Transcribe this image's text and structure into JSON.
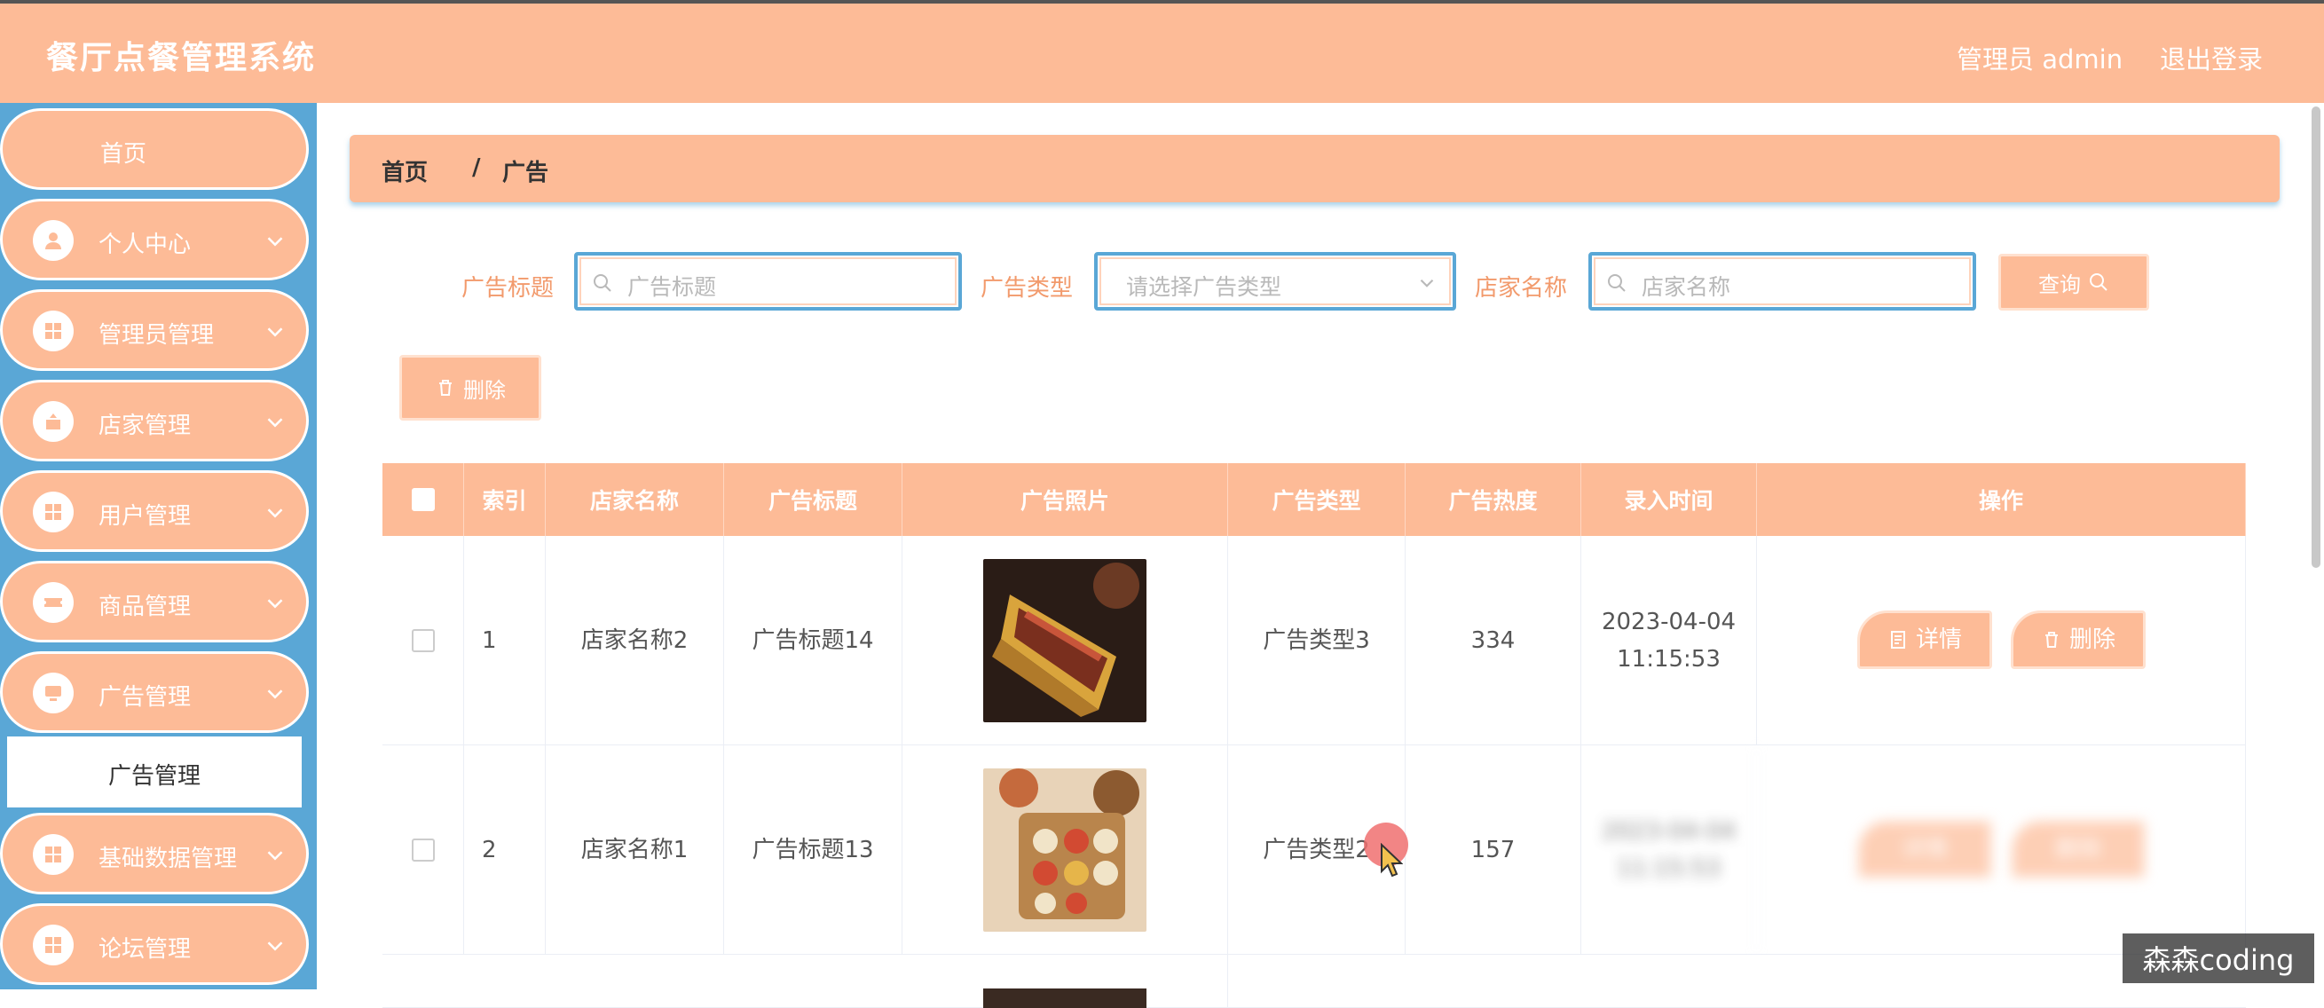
{
  "header": {
    "app_title": "餐厅点餐管理系统",
    "admin_info": "管理员 admin",
    "logout": "退出登录"
  },
  "sidebar": {
    "items": [
      {
        "label": "首页",
        "icon": "none"
      },
      {
        "label": "个人中心",
        "icon": "user-icon"
      },
      {
        "label": "管理员管理",
        "icon": "grid-icon"
      },
      {
        "label": "店家管理",
        "icon": "shop-icon"
      },
      {
        "label": "用户管理",
        "icon": "grid-icon"
      },
      {
        "label": "商品管理",
        "icon": "ticket-icon"
      },
      {
        "label": "广告管理",
        "icon": "monitor-icon"
      },
      {
        "label": "基础数据管理",
        "icon": "grid-icon"
      },
      {
        "label": "论坛管理",
        "icon": "grid-icon"
      }
    ],
    "active_sub": "广告管理"
  },
  "breadcrumb": {
    "home": "首页",
    "separator": "/",
    "current": "广告"
  },
  "search": {
    "title_label": "广告标题",
    "title_placeholder": "广告标题",
    "type_label": "广告类型",
    "type_placeholder": "请选择广告类型",
    "shop_label": "店家名称",
    "shop_placeholder": "店家名称",
    "query_button": "查询"
  },
  "toolbar": {
    "delete_button": "删除"
  },
  "table": {
    "columns": [
      "",
      "索引",
      "店家名称",
      "广告标题",
      "广告照片",
      "广告类型",
      "广告热度",
      "录入时间",
      "操作"
    ],
    "rows": [
      {
        "index": "1",
        "shop": "店家名称2",
        "title": "广告标题14",
        "type": "广告类型3",
        "heat": "334",
        "date": "2023-04-04",
        "time": "11:15:53",
        "detail": "详情",
        "delete": "删除"
      },
      {
        "index": "2",
        "shop": "店家名称1",
        "title": "广告标题13",
        "type": "广告类型2",
        "heat": "157",
        "date": "2023-04-04",
        "time": "11:15:53",
        "detail": "详情",
        "delete": "删除"
      }
    ]
  },
  "watermark": "森森coding",
  "colors": {
    "accent": "#fdbb97",
    "sidebar": "#5aa7d6",
    "label": "#f29a6c"
  }
}
